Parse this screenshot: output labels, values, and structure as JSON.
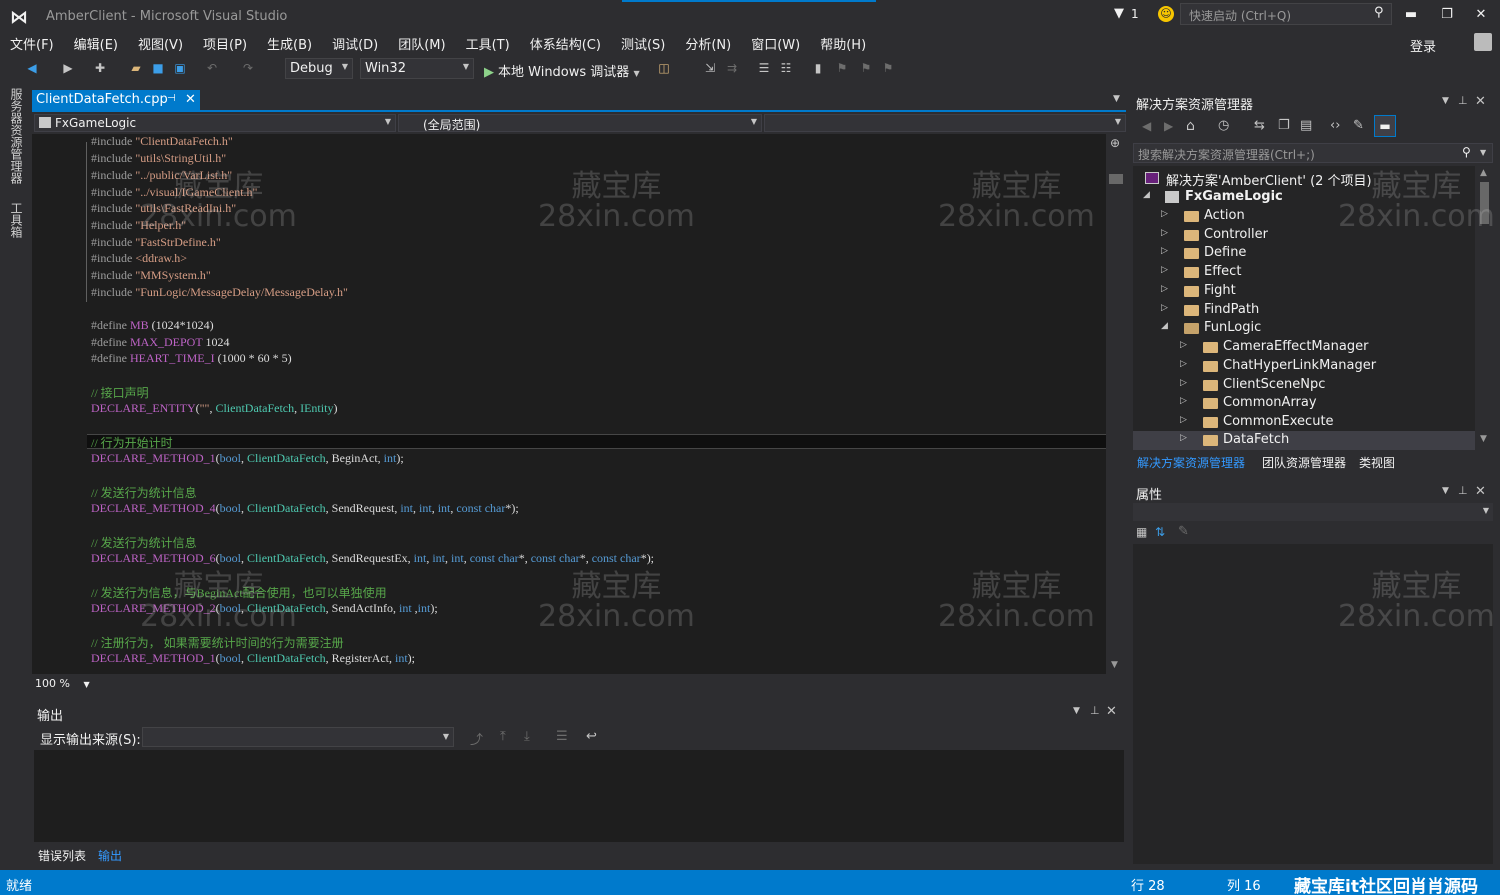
{
  "window": {
    "title": "AmberClient - Microsoft Visual Studio",
    "notification_count": "1",
    "quick_launch_placeholder": "快速启动 (Ctrl+Q)",
    "login": "登录"
  },
  "menu": [
    "文件(F)",
    "编辑(E)",
    "视图(V)",
    "项目(P)",
    "生成(B)",
    "调试(D)",
    "团队(M)",
    "工具(T)",
    "体系结构(C)",
    "测试(S)",
    "分析(N)",
    "窗口(W)",
    "帮助(H)"
  ],
  "toolbar": {
    "config": "Debug",
    "platform": "Win32",
    "run_label": "本地 Windows 调试器"
  },
  "left_tabs": [
    "服务器资源管理器",
    "工具箱"
  ],
  "editor": {
    "tab_title": "ClientDataFetch.cpp",
    "project_scope": "FxGameLogic",
    "member_scope": "(全局范围)",
    "zoom": "100 %"
  },
  "code": {
    "include_kw": "#include",
    "define_kw": "#define",
    "includes": [
      "\"ClientDataFetch.h\"",
      "\"utils\\StringUtil.h\"",
      "\"../public/VarList.h\"",
      "\"../visual/IGameClient.h\"",
      "\"utils\\FastReadIni.h\"",
      "\"Helper.h\"",
      "\"FastStrDefine.h\"",
      "<ddraw.h>",
      "\"MMSystem.h\"",
      "\"FunLogic/MessageDelay/MessageDelay.h\""
    ],
    "define1_name": "MB",
    "define1_val": "(1024*1024)",
    "define2_name": "MAX_DEPOT",
    "define2_val": "1024",
    "define3_name": "HEART_TIME_I",
    "define3_val": "(1000 * 60 * 5)",
    "c1": "// 接口声明",
    "decl_entity": "DECLARE_ENTITY",
    "decl_entity_str": "\"\"",
    "cls": "ClientDataFetch",
    "ientity": "IEntity",
    "c2": "// 行为开始计时",
    "m1": "DECLARE_METHOD_1",
    "m4": "DECLARE_METHOD_4",
    "m6": "DECLARE_METHOD_6",
    "m2": "DECLARE_METHOD_2",
    "t_bool": "bool",
    "t_int": "int",
    "t_const": "const",
    "t_char": "char",
    "f1": "BeginAct",
    "c3": "// 发送行为统计信息",
    "f2": "SendRequest",
    "c4": "// 发送行为统计信息",
    "f3": "SendRequestEx",
    "c5": "// 发送行为信息，与BeginAct配合使用，也可以单独使用",
    "f4": "SendActInfo",
    "c6": "// 注册行为， 如果需要统计时间的行为需要注册",
    "f5": "RegisterAct"
  },
  "output": {
    "title": "输出",
    "source_label": "显示输出来源(S):",
    "tabs": [
      "错误列表",
      "输出"
    ]
  },
  "solution_explorer": {
    "title": "解决方案资源管理器",
    "search_placeholder": "搜索解决方案资源管理器(Ctrl+;)",
    "solution": "解决方案'AmberClient' (2 个项目)",
    "project": "FxGameLogic",
    "folders": [
      "Action",
      "Controller",
      "Define",
      "Effect",
      "Fight",
      "FindPath",
      "FunLogic"
    ],
    "subfolders": [
      "CameraEffectManager",
      "ChatHyperLinkManager",
      "ClientSceneNpc",
      "CommonArray",
      "CommonExecute",
      "DataFetch"
    ],
    "tabs": [
      "解决方案资源管理器",
      "团队资源管理器",
      "类视图"
    ]
  },
  "properties": {
    "title": "属性"
  },
  "status": {
    "ready": "就绪",
    "line": "行 28",
    "col": "列 16",
    "brand": "藏宝库it社区回肖肖源码"
  },
  "watermark": {
    "line1": "藏宝库",
    "line2": "28xin.com"
  }
}
